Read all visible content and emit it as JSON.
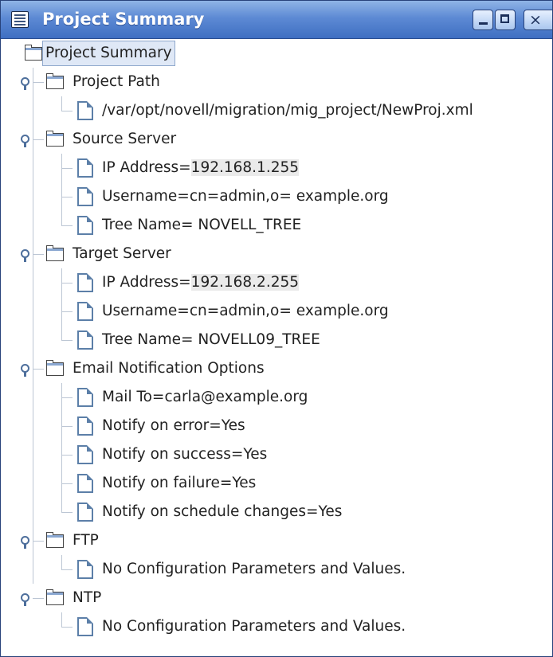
{
  "window": {
    "title": "Project Summary",
    "close_glyph": "×"
  },
  "tree": {
    "root": "Project Summary",
    "nodes": [
      {
        "label": "Project Path",
        "children": [
          {
            "text": "/var/opt/novell/migration/mig_project/NewProj.xml"
          }
        ]
      },
      {
        "label": "Source Server",
        "children": [
          {
            "key": "IP Address=",
            "value": "192.168.1.255"
          },
          {
            "key": "Username=",
            "value": "cn=admin,o= example.org"
          },
          {
            "key": "Tree Name=",
            "value": " NOVELL_TREE"
          }
        ]
      },
      {
        "label": "Target Server",
        "children": [
          {
            "key": "IP Address=",
            "value": "192.168.2.255"
          },
          {
            "key": "Username=",
            "value": "cn=admin,o= example.org"
          },
          {
            "key": "Tree Name=",
            "value": " NOVELL09_TREE"
          }
        ]
      },
      {
        "label": "Email Notification Options",
        "children": [
          {
            "key": "Mail To=",
            "value": "carla@example.org"
          },
          {
            "text": "Notify on error=Yes"
          },
          {
            "text": "Notify on success=Yes"
          },
          {
            "text": "Notify on failure=Yes"
          },
          {
            "text": "Notify on schedule changes=Yes"
          }
        ]
      },
      {
        "label": "FTP",
        "children": [
          {
            "text": "No Configuration Parameters and Values."
          }
        ]
      },
      {
        "label": "NTP",
        "children": [
          {
            "text": "No Configuration Parameters and Values."
          }
        ]
      }
    ]
  }
}
